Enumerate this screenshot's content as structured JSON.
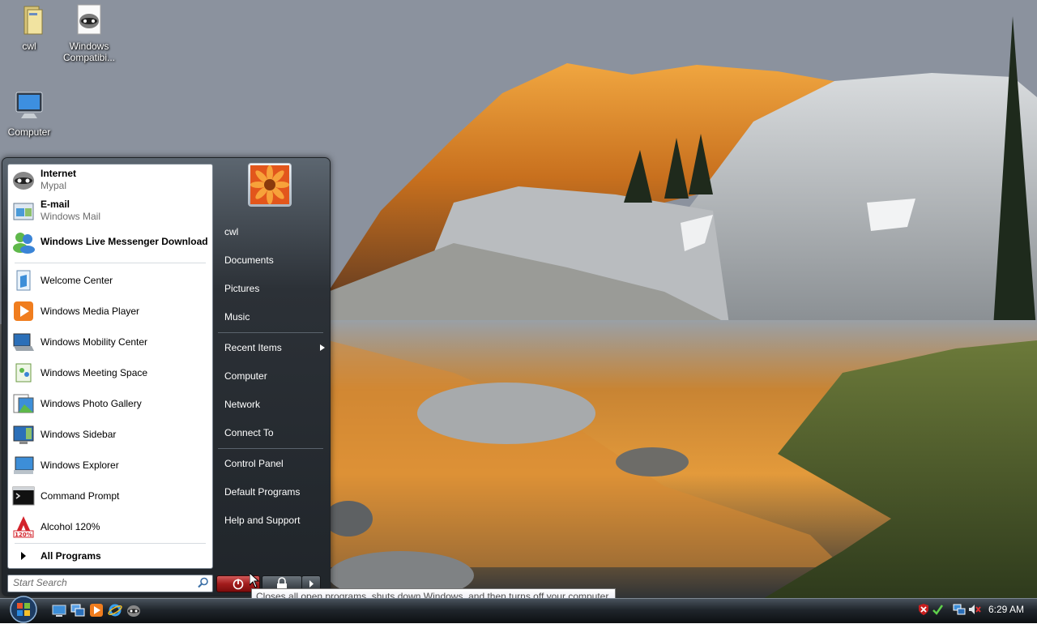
{
  "desktop": {
    "icons": [
      {
        "label": "cwl"
      },
      {
        "label": "Windows Compatibi..."
      },
      {
        "label": "Computer"
      }
    ]
  },
  "start_menu": {
    "pinned": [
      {
        "title": "Internet",
        "subtitle": "Mypal"
      },
      {
        "title": "E-mail",
        "subtitle": "Windows Mail"
      },
      {
        "title": "Windows Live Messenger Download"
      }
    ],
    "recent": [
      {
        "label": "Welcome Center"
      },
      {
        "label": "Windows Media Player"
      },
      {
        "label": "Windows Mobility Center"
      },
      {
        "label": "Windows Meeting Space"
      },
      {
        "label": "Windows Photo Gallery"
      },
      {
        "label": "Windows Sidebar"
      },
      {
        "label": "Windows Explorer"
      },
      {
        "label": "Command Prompt"
      },
      {
        "label": "Alcohol 120%"
      }
    ],
    "all_programs": "All Programs",
    "search_placeholder": "Start Search",
    "right_items": [
      {
        "label": "cwl"
      },
      {
        "label": "Documents"
      },
      {
        "label": "Pictures"
      },
      {
        "label": "Music"
      },
      {
        "label": "Recent Items"
      },
      {
        "label": "Computer"
      },
      {
        "label": "Network"
      },
      {
        "label": "Connect To"
      },
      {
        "label": "Control Panel"
      },
      {
        "label": "Default Programs"
      },
      {
        "label": "Help and Support"
      }
    ]
  },
  "tooltip": "Closes all open programs, shuts down Windows, and then turns off your computer.",
  "taskbar": {
    "clock": "6:29 AM",
    "quick_launch": [
      "show-desktop-icon",
      "switch-windows-icon",
      "media-player-icon",
      "internet-explorer-icon",
      "mypal-icon"
    ],
    "tray": [
      "security-alert-icon",
      "network-icon",
      "volume-muted-icon"
    ]
  }
}
